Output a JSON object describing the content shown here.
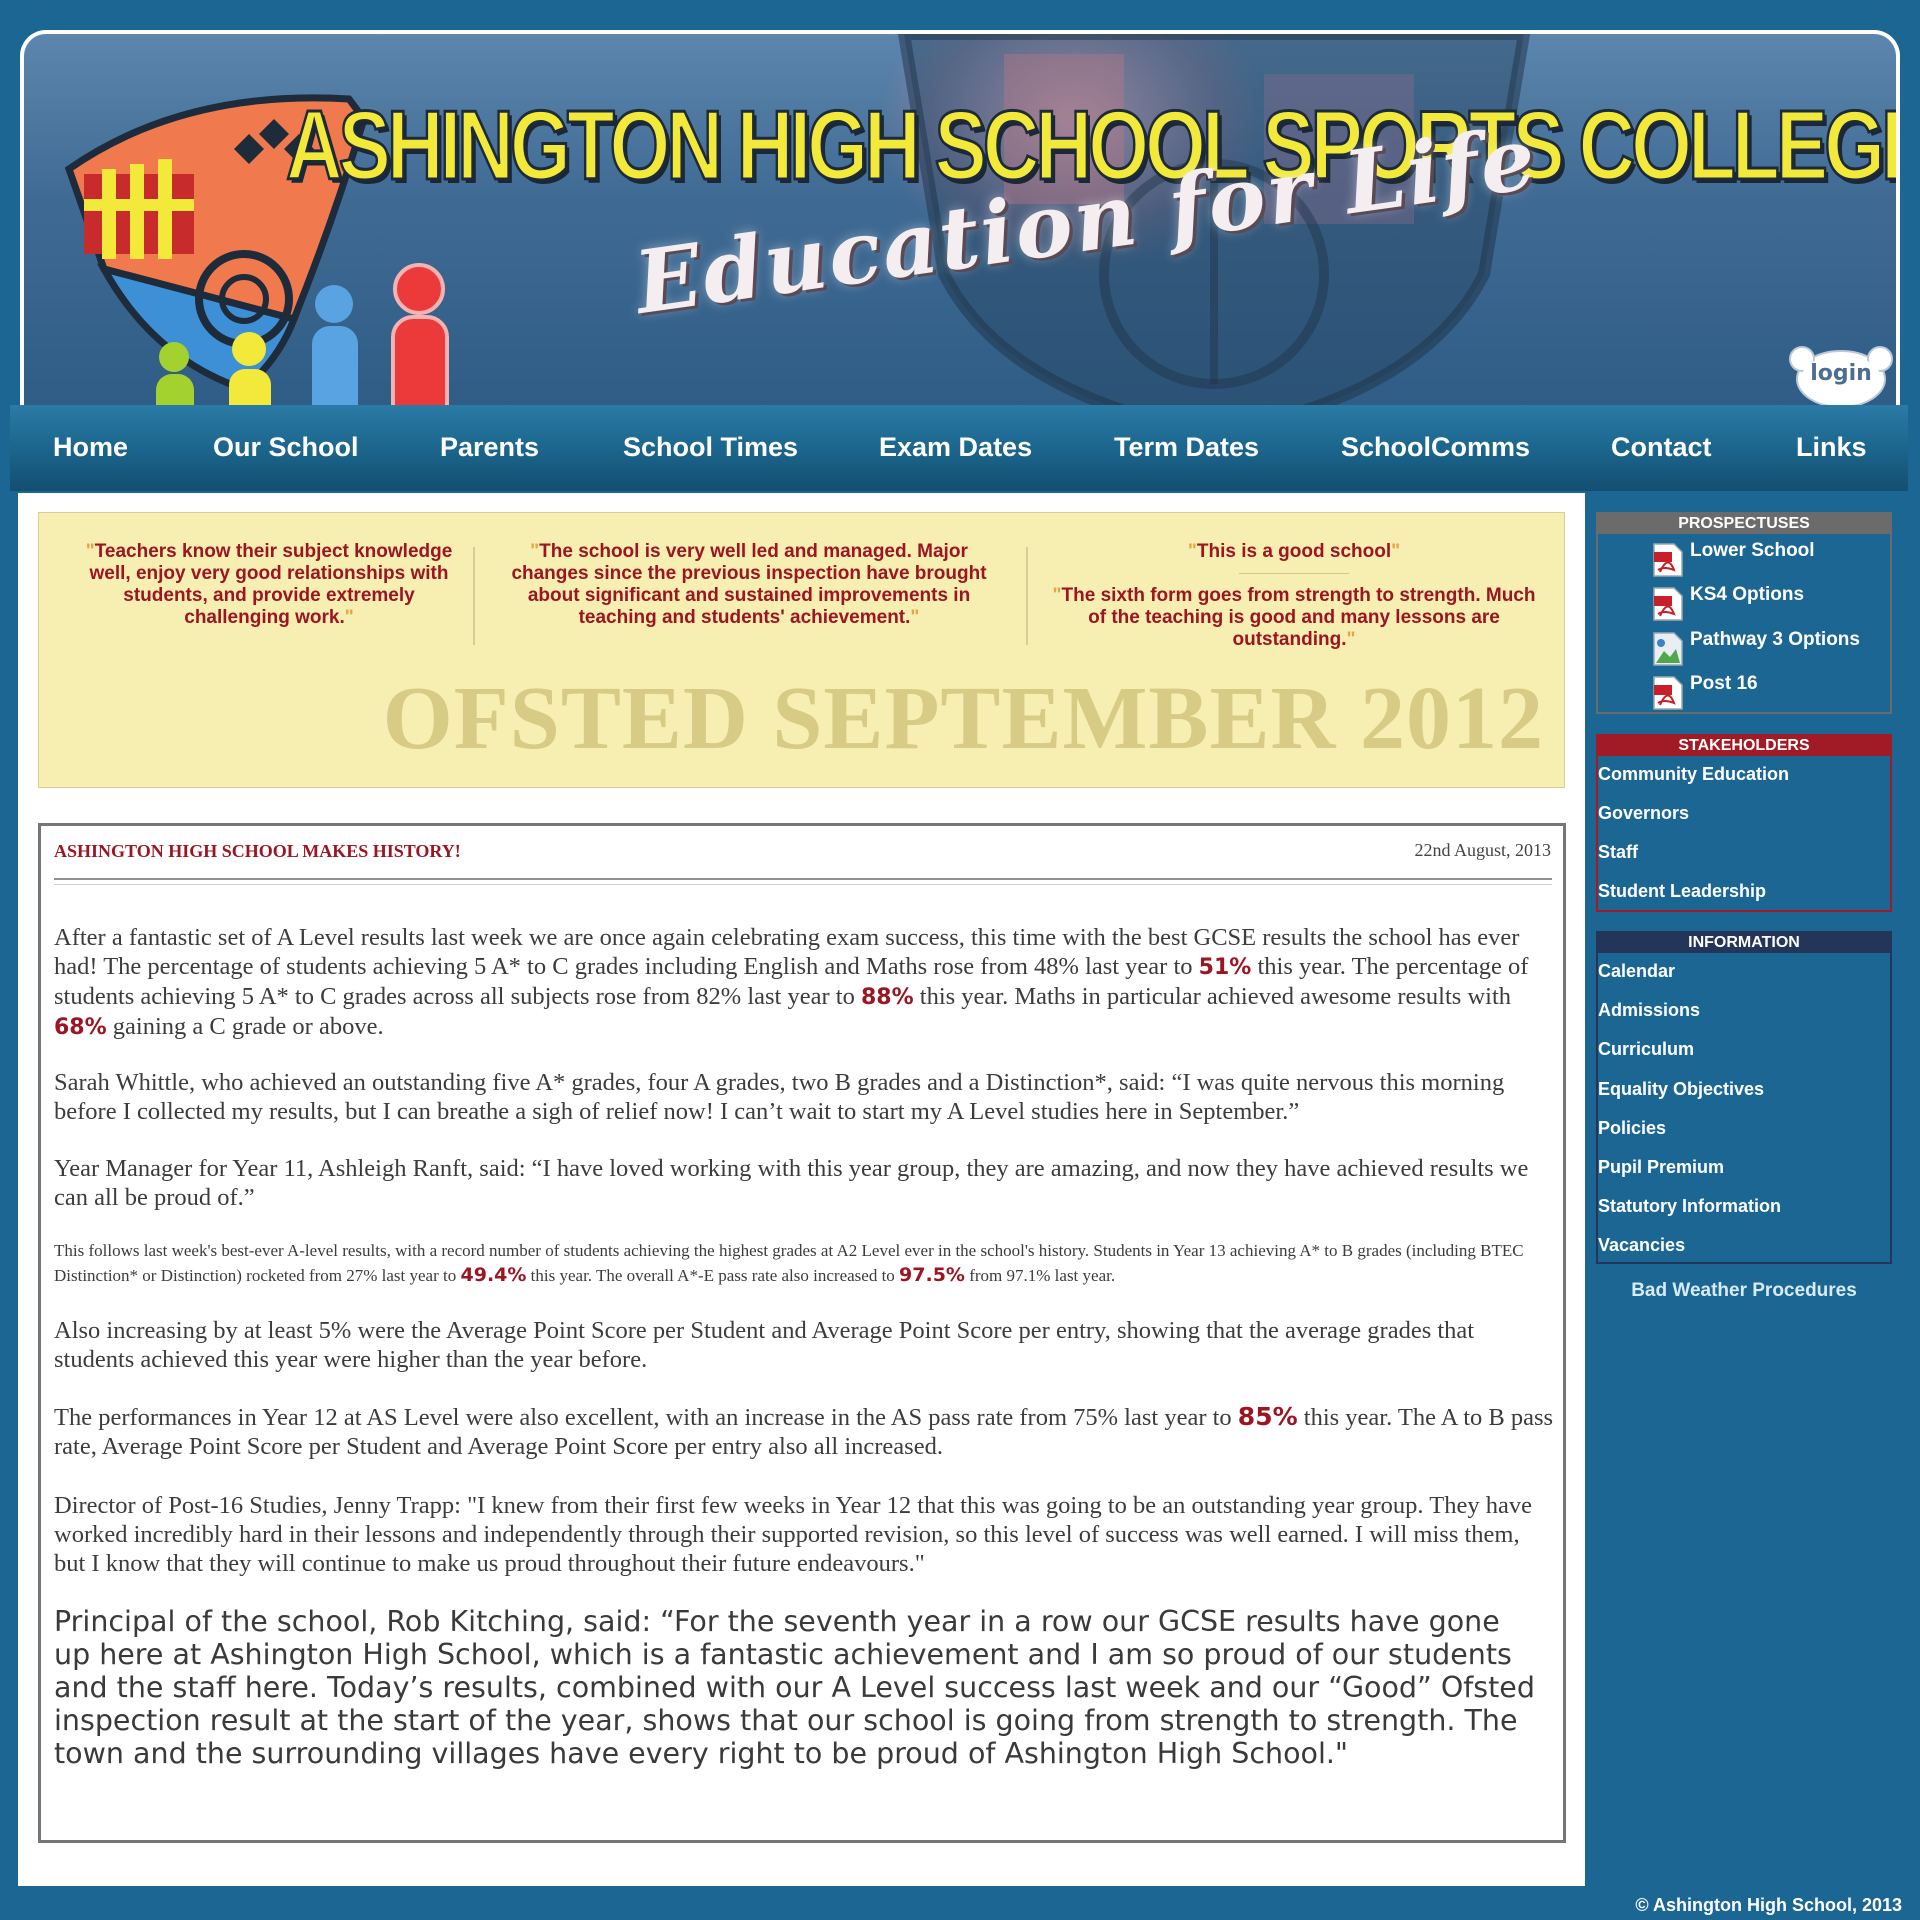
{
  "header": {
    "school_name": "ASHINGTON HIGH SCHOOL SPORTS COLLEGE",
    "tagline": "Education for Life",
    "login_label": "login"
  },
  "nav": {
    "items": [
      "Home",
      "Our School",
      "Parents",
      "School Times",
      "Exam Dates",
      "Term Dates",
      "SchoolComms",
      "Contact",
      "Links"
    ]
  },
  "ofsted": {
    "quote1": "Teachers know their subject knowledge well, enjoy very good relationships with students, and provide extremely challenging work.",
    "quote2": "The school is very well led and managed. Major changes since the previous inspection have brought about significant and sustained improvements in teaching and students' achievement.",
    "quote3": "This is a good school",
    "quote4": "The sixth form goes from strength to strength. Much of the teaching is good and many lessons are outstanding.",
    "title": "OFSTED SEPTEMBER 2012"
  },
  "article": {
    "title": "ASHINGTON HIGH SCHOOL MAKES HISTORY!",
    "date": "22nd August, 2013",
    "p1a": "After a fantastic set of A Level results last week we are once again celebrating exam success, this time with the best GCSE results the school has ever had!  The percentage of students achieving 5 A* to C grades including English and Maths rose from 48% last year to ",
    "p1_v1": "51%",
    "p1b": " this year. The percentage of students achieving 5 A* to C grades across all subjects rose from 82% last year to ",
    "p1_v2": "88%",
    "p1c": " this year. Maths in particular achieved awesome results with ",
    "p1_v3": "68%",
    "p1d": " gaining a C grade or above.",
    "p2": "Sarah Whittle, who achieved an outstanding five A* grades, four A grades, two B grades and a Distinction*, said: “I was quite nervous this morning before I collected my results, but I can breathe a sigh of relief now!  I can’t wait to start my A Level studies here in September.”",
    "p3": "Year Manager for Year 11, Ashleigh Ranft, said: “I have loved working with this year group, they are amazing, and now they have achieved results we can all be proud of.”",
    "p4a": "This follows last week's best-ever A-level results, with a record number of students achieving the highest grades at A2 Level ever in the school's history. Students in Year 13 achieving A* to B grades (including BTEC Distinction* or Distinction) rocketed from 27% last year to ",
    "p4_v1": "49.4%",
    "p4b": " this year. The overall A*-E pass rate also increased to ",
    "p4_v2": "97.5%",
    "p4c": " from 97.1% last year.",
    "p5": "Also increasing by at least 5% were the Average Point Score per Student and Average Point Score per entry, showing that the average grades that students achieved this year were higher than the year before.",
    "p6a": "The performances in Year 12 at AS Level were also excellent, with an increase in the AS pass rate from 75% last year to ",
    "p6_v1": "85%",
    "p6b": " this year. The A to B pass rate, Average Point Score per Student and Average Point Score per entry also all increased.",
    "p7": "Director of Post-16 Studies, Jenny Trapp: \"I knew from their first few weeks in Year 12 that this was going to be an outstanding year group. They have worked incredibly hard in their lessons and independently through their supported revision, so this level of success was well earned. I will miss them, but I know that they will continue to make us proud throughout their future endeavours.\"",
    "p8": "Principal of the school, Rob Kitching, said: “For the seventh year in a row our GCSE results have gone up here at Ashington High School, which is a fantastic achievement and I am so proud of our students and the staff here.  Today’s results, combined with our A Level success last week and our “Good” Ofsted inspection result at the start of the year, shows that our school is going from strength to strength. The town and the surrounding villages have every right to be proud of Ashington High School.\""
  },
  "sidebar": {
    "prospectuses": {
      "heading": "PROSPECTUSES",
      "items": [
        {
          "label": "Lower School",
          "icon": "pdf-icon"
        },
        {
          "label": "KS4 Options",
          "icon": "pdf-icon"
        },
        {
          "label": "Pathway 3 Options",
          "icon": "broken-image-icon"
        },
        {
          "label": "Post 16",
          "icon": "pdf-icon"
        }
      ]
    },
    "stakeholders": {
      "heading": "STAKEHOLDERS",
      "items": [
        "Community Education",
        "Governors",
        "Staff",
        "Student Leadership"
      ]
    },
    "information": {
      "heading": "INFORMATION",
      "items": [
        "Calendar",
        "Admissions",
        "Curriculum",
        "Equality Objectives",
        "Policies",
        "Pupil Premium",
        "Statutory Information",
        "Vacancies"
      ]
    },
    "bad_weather": "Bad Weather Procedures"
  },
  "footer": {
    "copyright": "© Ashington High School, 2013"
  },
  "colors": {
    "page_bg": "#1b6693",
    "nav_bg": "#1d6890",
    "accent_red": "#9b1522",
    "ofsted_bg": "#f7eeb1",
    "title_yellow": "#f2e93a"
  }
}
